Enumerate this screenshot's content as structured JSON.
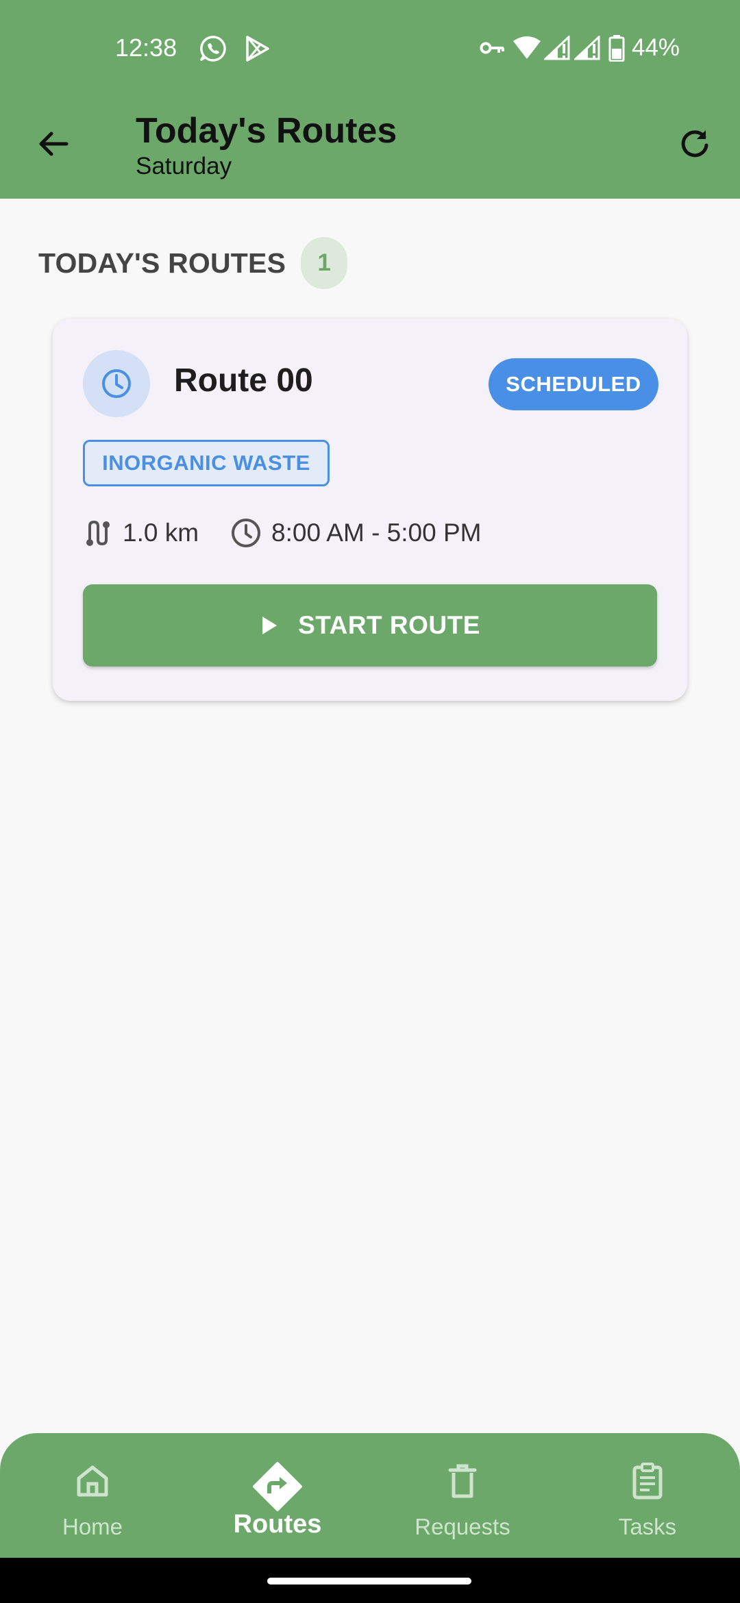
{
  "status_bar": {
    "time": "12:38",
    "battery_percent": "44%",
    "icons": [
      "whatsapp-icon",
      "play-store-icon",
      "vpn-key-icon",
      "wifi-icon",
      "signal-icon",
      "signal-icon",
      "battery-icon"
    ]
  },
  "app_bar": {
    "title": "Today's Routes",
    "subtitle": "Saturday",
    "back_icon": "arrow-back-icon",
    "refresh_icon": "refresh-icon"
  },
  "section": {
    "title": "TODAY'S ROUTES",
    "count": "1"
  },
  "routes": [
    {
      "name": "Route 00",
      "status": "SCHEDULED",
      "waste_type": "INORGANIC WASTE",
      "distance": "1.0 km",
      "time_window": "8:00 AM - 5:00 PM",
      "start_label": "START ROUTE"
    }
  ],
  "bottom_nav": {
    "items": [
      {
        "label": "Home",
        "icon": "home-icon",
        "active": false
      },
      {
        "label": "Routes",
        "icon": "directions-icon",
        "active": true
      },
      {
        "label": "Requests",
        "icon": "trash-bin-icon",
        "active": false
      },
      {
        "label": "Tasks",
        "icon": "clipboard-icon",
        "active": false
      }
    ]
  },
  "colors": {
    "primary_green": "#6da86b",
    "scheduled_blue": "#4a8fe6",
    "background": "#f8f8f8",
    "card_background": "#f4f2f8"
  }
}
